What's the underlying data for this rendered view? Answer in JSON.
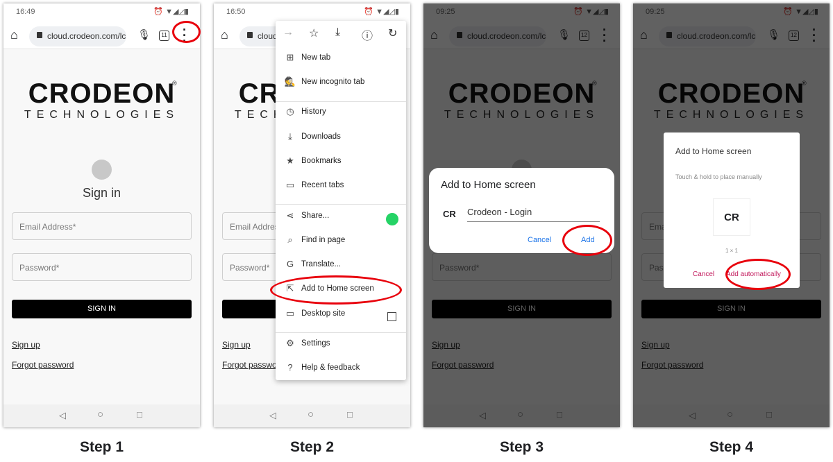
{
  "steps": [
    {
      "label": "Step 1",
      "time": "16:49",
      "url": "cloud.crodeon.com/lc",
      "tabs": "11"
    },
    {
      "label": "Step 2",
      "time": "16:50",
      "url": "cloud.crodeon.com/lc",
      "tabs": "11"
    },
    {
      "label": "Step 3",
      "time": "09:25",
      "url": "cloud.crodeon.com/lc",
      "tabs": "12"
    },
    {
      "label": "Step 4",
      "time": "09:25",
      "url": "cloud.crodeon.com/lc",
      "tabs": "12"
    }
  ],
  "page": {
    "logo": "CRODEON",
    "logo_sub": "TECHNOLOGIES",
    "registered": "®",
    "title": "Sign in",
    "email_placeholder": "Email Address*",
    "password_placeholder": "Password*",
    "sign_in": "SIGN IN",
    "sign_up": "Sign up",
    "forgot": "Forgot password"
  },
  "menu": {
    "items": [
      {
        "icon": "plus-box-icon",
        "glyph": "⊞",
        "label": "New tab"
      },
      {
        "icon": "incognito-icon",
        "glyph": "🕵",
        "label": "New incognito tab"
      },
      {
        "icon": "history-icon",
        "glyph": "◷",
        "label": "History"
      },
      {
        "icon": "download-icon",
        "glyph": "⤓",
        "label": "Downloads"
      },
      {
        "icon": "star-icon",
        "glyph": "★",
        "label": "Bookmarks"
      },
      {
        "icon": "devices-icon",
        "glyph": "▭",
        "label": "Recent tabs"
      },
      {
        "icon": "share-icon",
        "glyph": "⋖",
        "label": "Share..."
      },
      {
        "icon": "find-icon",
        "glyph": "⌕",
        "label": "Find in page"
      },
      {
        "icon": "translate-icon",
        "glyph": "G",
        "label": "Translate..."
      },
      {
        "icon": "add-home-icon",
        "glyph": "⇱",
        "label": "Add to Home screen"
      },
      {
        "icon": "desktop-icon",
        "glyph": "▭",
        "label": "Desktop site"
      },
      {
        "icon": "gear-icon",
        "glyph": "⚙",
        "label": "Settings"
      },
      {
        "icon": "help-icon",
        "glyph": "?",
        "label": "Help & feedback"
      }
    ]
  },
  "dialog3": {
    "title": "Add to Home screen",
    "app_icon": "CR",
    "name_value": "Crodeon - Login",
    "cancel": "Cancel",
    "add": "Add"
  },
  "dialog4": {
    "title": "Add to Home screen",
    "hint": "Touch & hold to place manually",
    "icon": "CR",
    "size": "1 × 1",
    "cancel": "Cancel",
    "add": "Add automatically"
  },
  "colors": {
    "highlight": "#e8000b",
    "dialog_link": "#1a73e8",
    "dialog4_link": "#c2185b"
  }
}
